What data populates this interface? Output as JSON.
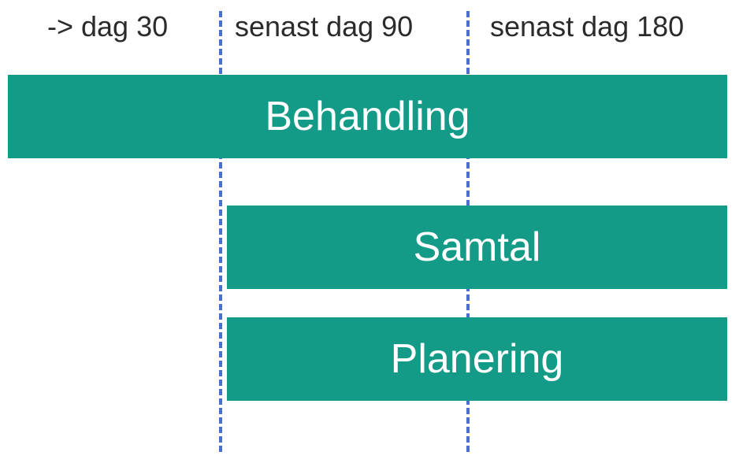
{
  "chart_data": {
    "type": "bar",
    "orientation": "horizontal-timeline",
    "time_axis": {
      "milestones": [
        {
          "label": "-> dag 30",
          "position_days": 30
        },
        {
          "label": "senast dag 90",
          "position_days": 90
        },
        {
          "label": "senast dag 180",
          "position_days": 180
        }
      ]
    },
    "series": [
      {
        "name": "Behandling",
        "start_day": 0,
        "end_day": 180
      },
      {
        "name": "Samtal",
        "start_day": 30,
        "end_day": 180
      },
      {
        "name": "Planering",
        "start_day": 30,
        "end_day": 180
      }
    ],
    "title": "",
    "xlabel": "",
    "ylabel": ""
  },
  "headers": {
    "col1": "-> dag 30",
    "col2": "senast dag 90",
    "col3": "senast dag 180"
  },
  "bars": {
    "behandling": "Behandling",
    "samtal": "Samtal",
    "planering": "Planering"
  },
  "colors": {
    "bar_fill": "#149b87",
    "divider": "#4a6fd0",
    "text": "#2b2b2b"
  }
}
